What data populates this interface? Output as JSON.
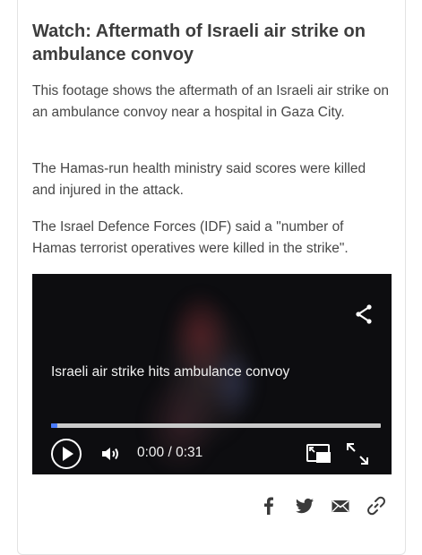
{
  "article": {
    "title": "Watch: Aftermath of Israeli air strike on ambulance convoy",
    "paragraphs": [
      "This footage shows the aftermath of an Israeli air strike on an ambulance convoy near a hospital in Gaza City.",
      "The Hamas-run health ministry said scores were killed and injured in the attack.",
      "The Israel Defence Forces (IDF) said a \"number of Hamas terrorist operatives were killed in the strike\"."
    ]
  },
  "video": {
    "caption": "Israeli air strike hits ambulance convoy",
    "time": "0:00 / 0:31",
    "progress_fraction": 0.0,
    "accent_color": "#4a7bff",
    "icons": [
      "share-icon",
      "play-icon",
      "volume-icon",
      "picture-in-picture-icon",
      "fullscreen-icon"
    ]
  },
  "share_bar": {
    "icons": [
      "facebook-icon",
      "twitter-icon",
      "email-icon",
      "link-icon"
    ]
  }
}
